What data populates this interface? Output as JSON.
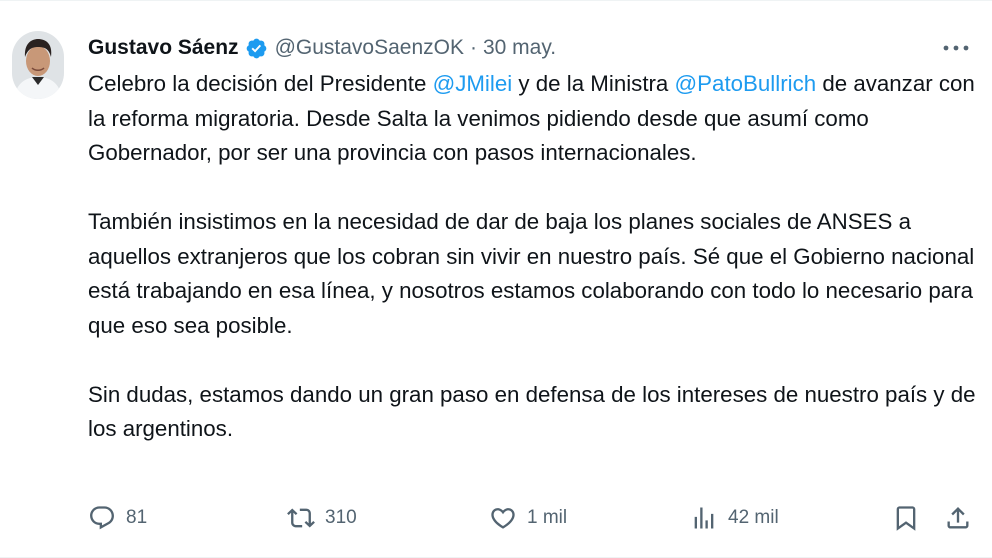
{
  "colors": {
    "accent": "#1d9bf0",
    "text": "#0f1419",
    "secondary": "#536471"
  },
  "author": {
    "name": "Gustavo Sáenz",
    "handle": "@GustavoSaenzOK",
    "separator": "·",
    "date": "30 may.",
    "verified_icon": "verified-badge-icon",
    "avatar": "profile-photo"
  },
  "tweet": {
    "p1_a": "Celebro la decisión del Presidente ",
    "mention1": "@JMilei",
    "p1_b": " y de la Ministra ",
    "mention2": "@PatoBullrich",
    "p1_c": " de avanzar con la reforma migratoria. Desde Salta la venimos pidiendo desde que asumí como Gobernador, por ser una provincia con pasos internacionales.",
    "p2": "También insistimos en la necesidad de dar de baja los planes sociales de ANSES a aquellos extranjeros que los cobran sin vivir en nuestro país. Sé que el Gobierno nacional está trabajando en esa línea, y nosotros estamos colaborando con todo lo necesario para que eso sea posible.",
    "p3": "Sin dudas, estamos dando un gran paso en defensa de los intereses de nuestro país y de los argentinos."
  },
  "actions": {
    "replies": "81",
    "reposts": "310",
    "likes": "1 mil",
    "views": "42 mil",
    "icons": [
      "reply-icon",
      "repost-icon",
      "like-icon",
      "views-icon",
      "bookmark-icon",
      "share-icon",
      "more-icon"
    ]
  }
}
